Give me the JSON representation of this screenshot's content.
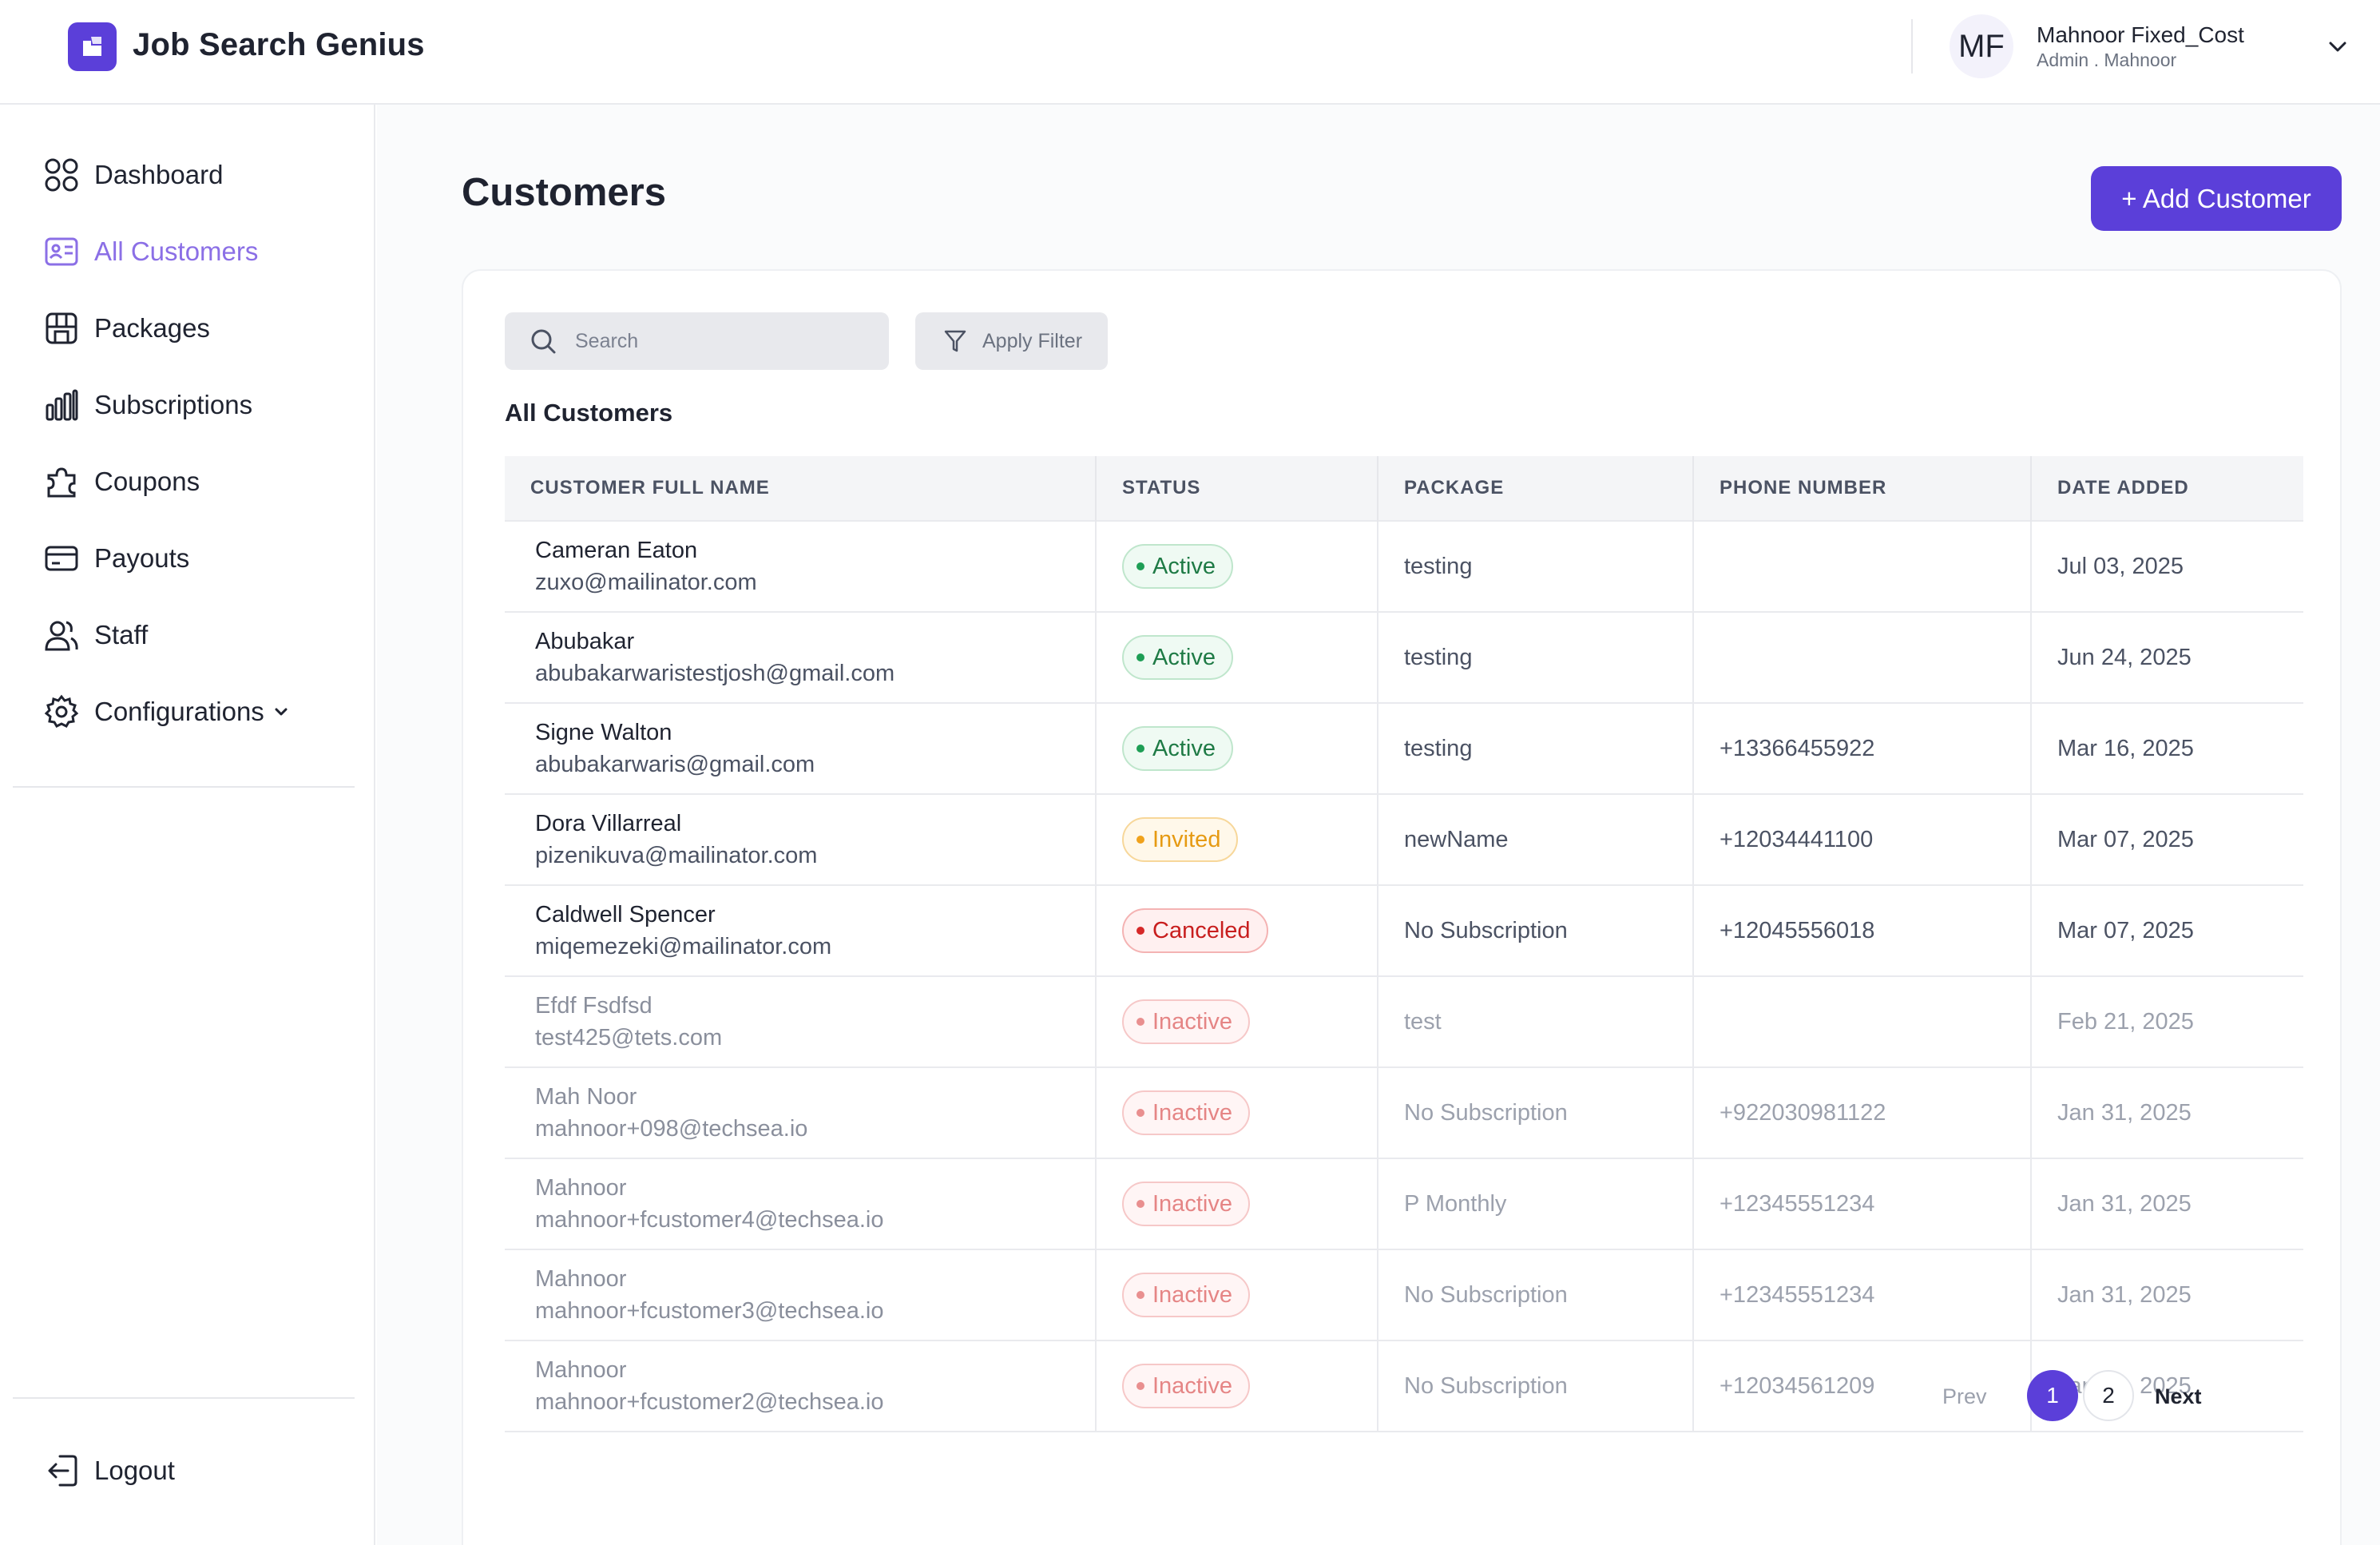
{
  "app": {
    "name": "Job Search Genius"
  },
  "user": {
    "initials": "MF",
    "name": "Mahnoor Fixed_Cost",
    "role": "Admin . Mahnoor"
  },
  "sidebar": {
    "items": [
      {
        "label": "Dashboard",
        "icon": "dashboard-grid-icon"
      },
      {
        "label": "All Customers",
        "icon": "id-card-icon",
        "active": true
      },
      {
        "label": "Packages",
        "icon": "package-icon"
      },
      {
        "label": "Subscriptions",
        "icon": "bar-chart-icon"
      },
      {
        "label": "Coupons",
        "icon": "coupon-icon"
      },
      {
        "label": "Payouts",
        "icon": "card-icon"
      },
      {
        "label": "Staff",
        "icon": "users-icon"
      },
      {
        "label": "Configurations",
        "icon": "gear-icon"
      }
    ],
    "logout": "Logout"
  },
  "page": {
    "title": "Customers",
    "add_button": "+ Add Customer",
    "search_placeholder": "Search",
    "filter_button": "Apply Filter",
    "section_title": "All Customers"
  },
  "table": {
    "columns": [
      "CUSTOMER FULL NAME",
      "STATUS",
      "PACKAGE",
      "PHONE NUMBER",
      "DATE ADDED"
    ],
    "rows": [
      {
        "name": "Cameran Eaton",
        "email": "zuxo@mailinator.com",
        "status": "Active",
        "package": "testing",
        "phone": "",
        "date": "Jul 03, 2025"
      },
      {
        "name": "Abubakar",
        "email": "abubakarwaristestjosh@gmail.com",
        "status": "Active",
        "package": "testing",
        "phone": "",
        "date": "Jun 24, 2025"
      },
      {
        "name": "Signe Walton",
        "email": "abubakarwaris@gmail.com",
        "status": "Active",
        "package": "testing",
        "phone": "+13366455922",
        "date": "Mar 16, 2025"
      },
      {
        "name": "Dora Villarreal",
        "email": "pizenikuva@mailinator.com",
        "status": "Invited",
        "package": "newName",
        "phone": "+12034441100",
        "date": "Mar 07, 2025"
      },
      {
        "name": "Caldwell Spencer",
        "email": "miqemezeki@mailinator.com",
        "status": "Canceled",
        "package": "No Subscription",
        "phone": "+12045556018",
        "date": "Mar 07, 2025"
      },
      {
        "name": "Efdf Fsdfsd",
        "email": "test425@tets.com",
        "status": "Inactive",
        "package": "test",
        "phone": "",
        "date": "Feb 21, 2025"
      },
      {
        "name": "Mah Noor",
        "email": "mahnoor+098@techsea.io",
        "status": "Inactive",
        "package": "No Subscription",
        "phone": "+922030981122",
        "date": "Jan 31, 2025"
      },
      {
        "name": "Mahnoor",
        "email": "mahnoor+fcustomer4@techsea.io",
        "status": "Inactive",
        "package": "P Monthly",
        "phone": "+12345551234",
        "date": "Jan 31, 2025"
      },
      {
        "name": "Mahnoor",
        "email": "mahnoor+fcustomer3@techsea.io",
        "status": "Inactive",
        "package": "No Subscription",
        "phone": "+12345551234",
        "date": "Jan 31, 2025"
      },
      {
        "name": "Mahnoor",
        "email": "mahnoor+fcustomer2@techsea.io",
        "status": "Inactive",
        "package": "No Subscription",
        "phone": "+12034561209",
        "date": "Jan 31, 2025"
      }
    ]
  },
  "pagination": {
    "prev": "Prev",
    "pages": [
      "1",
      "2"
    ],
    "current": "1",
    "next": "Next"
  },
  "colors": {
    "accent": "#5b3fd9",
    "active_nav": "#8b6fe6",
    "status_active": "#1e7a45",
    "status_invited": "#e69a12",
    "status_canceled": "#c81e1e",
    "status_inactive": "#e58585"
  }
}
